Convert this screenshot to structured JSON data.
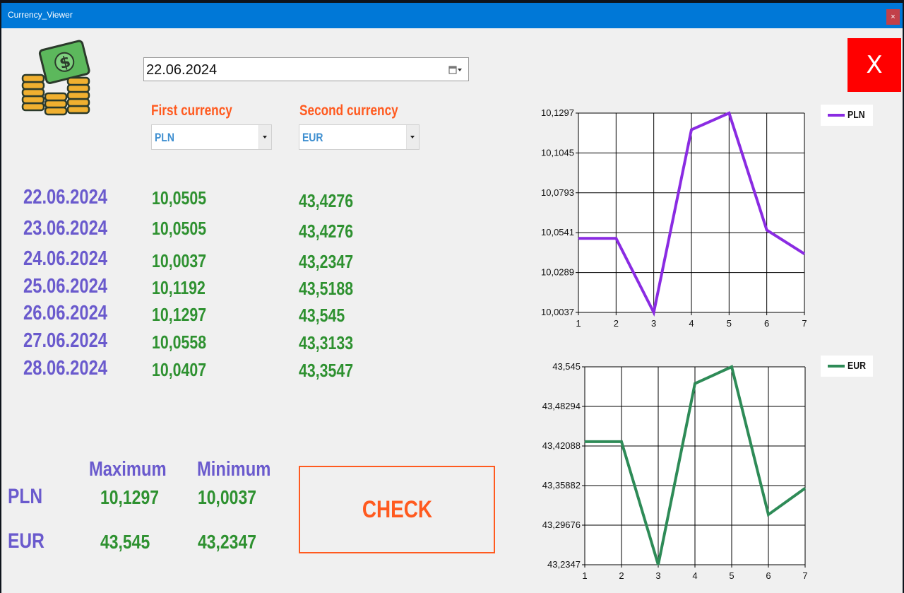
{
  "window": {
    "title": "Currency_Viewer",
    "close_glyph": "×"
  },
  "date_picker": {
    "value": "22.06.2024",
    "icon": "calendar-dropdown-icon"
  },
  "exit_button": {
    "label": "X",
    "color": "#ff0000"
  },
  "labels": {
    "first_currency": "First currency",
    "second_currency": "Second currency"
  },
  "first_currency_select": {
    "selected": "PLN"
  },
  "second_currency_select": {
    "selected": "EUR"
  },
  "rates": [
    {
      "date": "22.06.2024",
      "first": "10,0505",
      "second": "43,4276"
    },
    {
      "date": "23.06.2024",
      "first": "10,0505",
      "second": "43,4276"
    },
    {
      "date": "24.06.2024",
      "first": "10,0037",
      "second": "43,2347"
    },
    {
      "date": "25.06.2024",
      "first": "10,1192",
      "second": "43,5188"
    },
    {
      "date": "26.06.2024",
      "first": "10,1297",
      "second": "43,545"
    },
    {
      "date": "27.06.2024",
      "first": "10,0558",
      "second": "43,3133"
    },
    {
      "date": "28.06.2024",
      "first": "10,0407",
      "second": "43,3547"
    }
  ],
  "stats": {
    "max_header": "Maximum",
    "min_header": "Minimum",
    "rows": [
      {
        "currency": "PLN",
        "max": "10,1297",
        "min": "10,0037"
      },
      {
        "currency": "EUR",
        "max": "43,545",
        "min": "43,2347"
      }
    ]
  },
  "check_button": {
    "label": "CHECK"
  },
  "colors": {
    "accent_orange": "#ff5a1f",
    "date_purple": "#6a5acd",
    "value_green": "#2e9130",
    "titlebar": "#0078d7"
  },
  "chart_data": [
    {
      "type": "line",
      "x": [
        1,
        2,
        3,
        4,
        5,
        6,
        7
      ],
      "series": [
        {
          "name": "PLN",
          "values": [
            10.0505,
            10.0505,
            10.0037,
            10.1192,
            10.1297,
            10.0558,
            10.0407
          ],
          "color": "#8a2be2"
        }
      ],
      "ylim": [
        10.0037,
        10.1297
      ],
      "yticks": [
        "10,0037",
        "10,0289",
        "10,0541",
        "10,0793",
        "10,1045",
        "10,1297"
      ],
      "xticks": [
        "1",
        "2",
        "3",
        "4",
        "5",
        "6",
        "7"
      ],
      "grid": true,
      "legend": "top-right"
    },
    {
      "type": "line",
      "x": [
        1,
        2,
        3,
        4,
        5,
        6,
        7
      ],
      "series": [
        {
          "name": "EUR",
          "values": [
            43.4276,
            43.4276,
            43.2347,
            43.5188,
            43.545,
            43.3133,
            43.3547
          ],
          "color": "#2e8b57"
        }
      ],
      "ylim": [
        43.2347,
        43.545
      ],
      "yticks": [
        "43,2347",
        "43,29676",
        "43,35882",
        "43,42088",
        "43,48294",
        "43,545"
      ],
      "xticks": [
        "1",
        "2",
        "3",
        "4",
        "5",
        "6",
        "7"
      ],
      "grid": true,
      "legend": "top-right"
    }
  ]
}
